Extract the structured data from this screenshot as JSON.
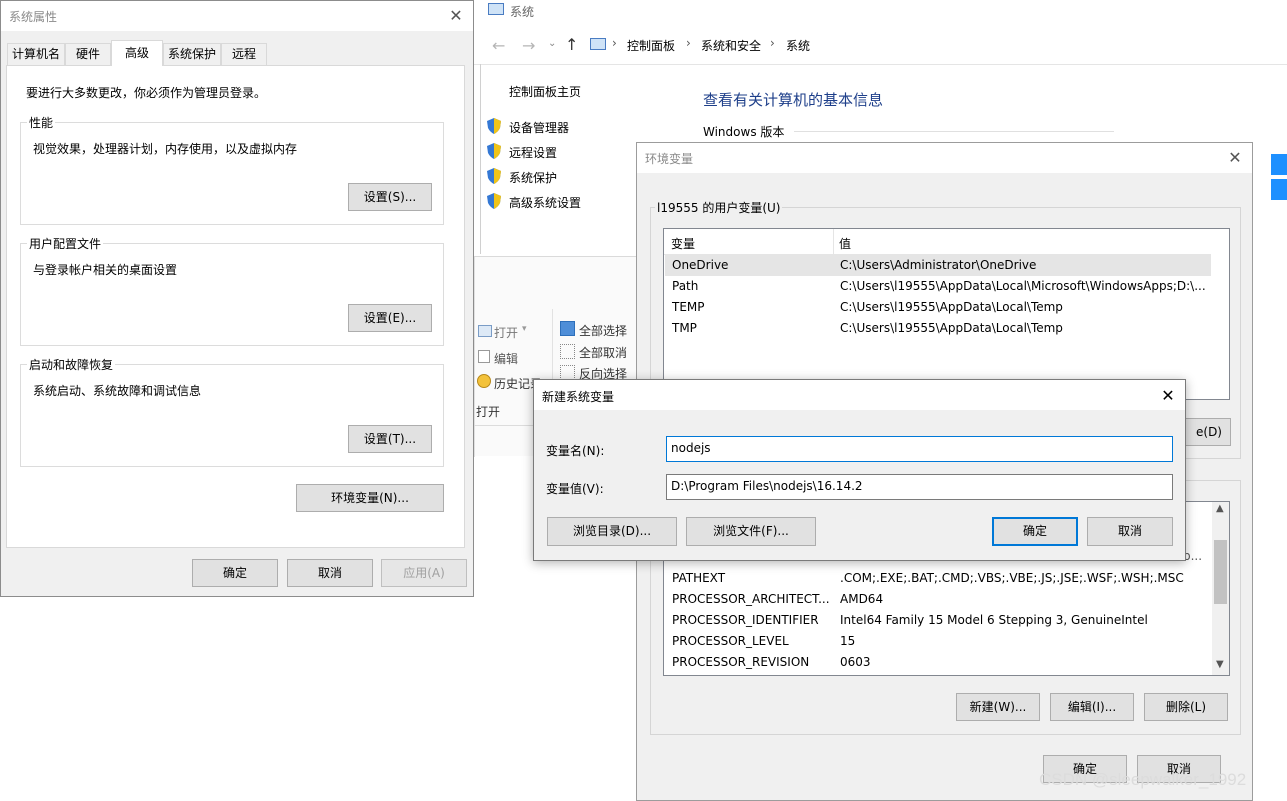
{
  "system_props": {
    "title": "系统属性",
    "tabs": [
      "计算机名",
      "硬件",
      "高级",
      "系统保护",
      "远程"
    ],
    "admin_notice": "要进行大多数更改，你必须作为管理员登录。",
    "performance": {
      "label": "性能",
      "desc": "视觉效果，处理器计划，内存使用，以及虚拟内存",
      "button": "设置(S)..."
    },
    "user_profile": {
      "label": "用户配置文件",
      "desc": "与登录帐户相关的桌面设置",
      "button": "设置(E)..."
    },
    "startup": {
      "label": "启动和故障恢复",
      "desc": "系统启动、系统故障和调试信息",
      "button": "设置(T)..."
    },
    "env_button": "环境变量(N)...",
    "ok": "确定",
    "cancel": "取消",
    "apply": "应用(A)"
  },
  "system_window": {
    "title": "系统",
    "breadcrumb": [
      "控制面板",
      "系统和安全",
      "系统"
    ],
    "home_link": "控制面板主页",
    "side_links": [
      "设备管理器",
      "远程设置",
      "系统保护",
      "高级系统设置"
    ],
    "heading": "查看有关计算机的基本信息",
    "windows_edition": "Windows 版本"
  },
  "ribbon": {
    "open": "打开",
    "edit": "编辑",
    "history": "历史记录",
    "select_all": "全部选择",
    "select_none": "全部取消",
    "invert": "反向选择",
    "group_label": "打开"
  },
  "env_vars": {
    "title": "环境变量",
    "user_group": "l19555 的用户变量(U)",
    "col_var": "变量",
    "col_val": "值",
    "user_rows": [
      {
        "name": "OneDrive",
        "value": "C:\\Users\\Administrator\\OneDrive"
      },
      {
        "name": "Path",
        "value": "C:\\Users\\l19555\\AppData\\Local\\Microsoft\\WindowsApps;D:\\..."
      },
      {
        "name": "TEMP",
        "value": "C:\\Users\\l19555\\AppData\\Local\\Temp"
      },
      {
        "name": "TMP",
        "value": "C:\\Users\\l19555\\AppData\\Local\\Temp"
      }
    ],
    "user_delete_partial": "e(D)",
    "sys_partial_value": "b...",
    "sys_rows": [
      {
        "name": "PATHEXT",
        "value": ".COM;.EXE;.BAT;.CMD;.VBS;.VBE;.JS;.JSE;.WSF;.WSH;.MSC"
      },
      {
        "name": "PROCESSOR_ARCHITECT...",
        "value": "AMD64"
      },
      {
        "name": "PROCESSOR_IDENTIFIER",
        "value": "Intel64 Family 15 Model 6 Stepping 3, GenuineIntel"
      },
      {
        "name": "PROCESSOR_LEVEL",
        "value": "15"
      },
      {
        "name": "PROCESSOR_REVISION",
        "value": "0603"
      }
    ],
    "new_button": "新建(W)...",
    "edit_button": "编辑(I)...",
    "delete_button": "删除(L)",
    "ok": "确定",
    "cancel": "取消"
  },
  "new_var": {
    "title": "新建系统变量",
    "name_label": "变量名(N):",
    "name_value": "nodejs",
    "value_label": "变量值(V):",
    "value_value": "D:\\Program Files\\nodejs\\16.14.2",
    "browse_dir": "浏览目录(D)...",
    "browse_file": "浏览文件(F)...",
    "ok": "确定",
    "cancel": "取消"
  },
  "watermark": "CSDN @sleepwalker_1992",
  "colors": {
    "accent": "#0078d7",
    "link": "#1a5fb4",
    "heading": "#1e3f8a"
  }
}
